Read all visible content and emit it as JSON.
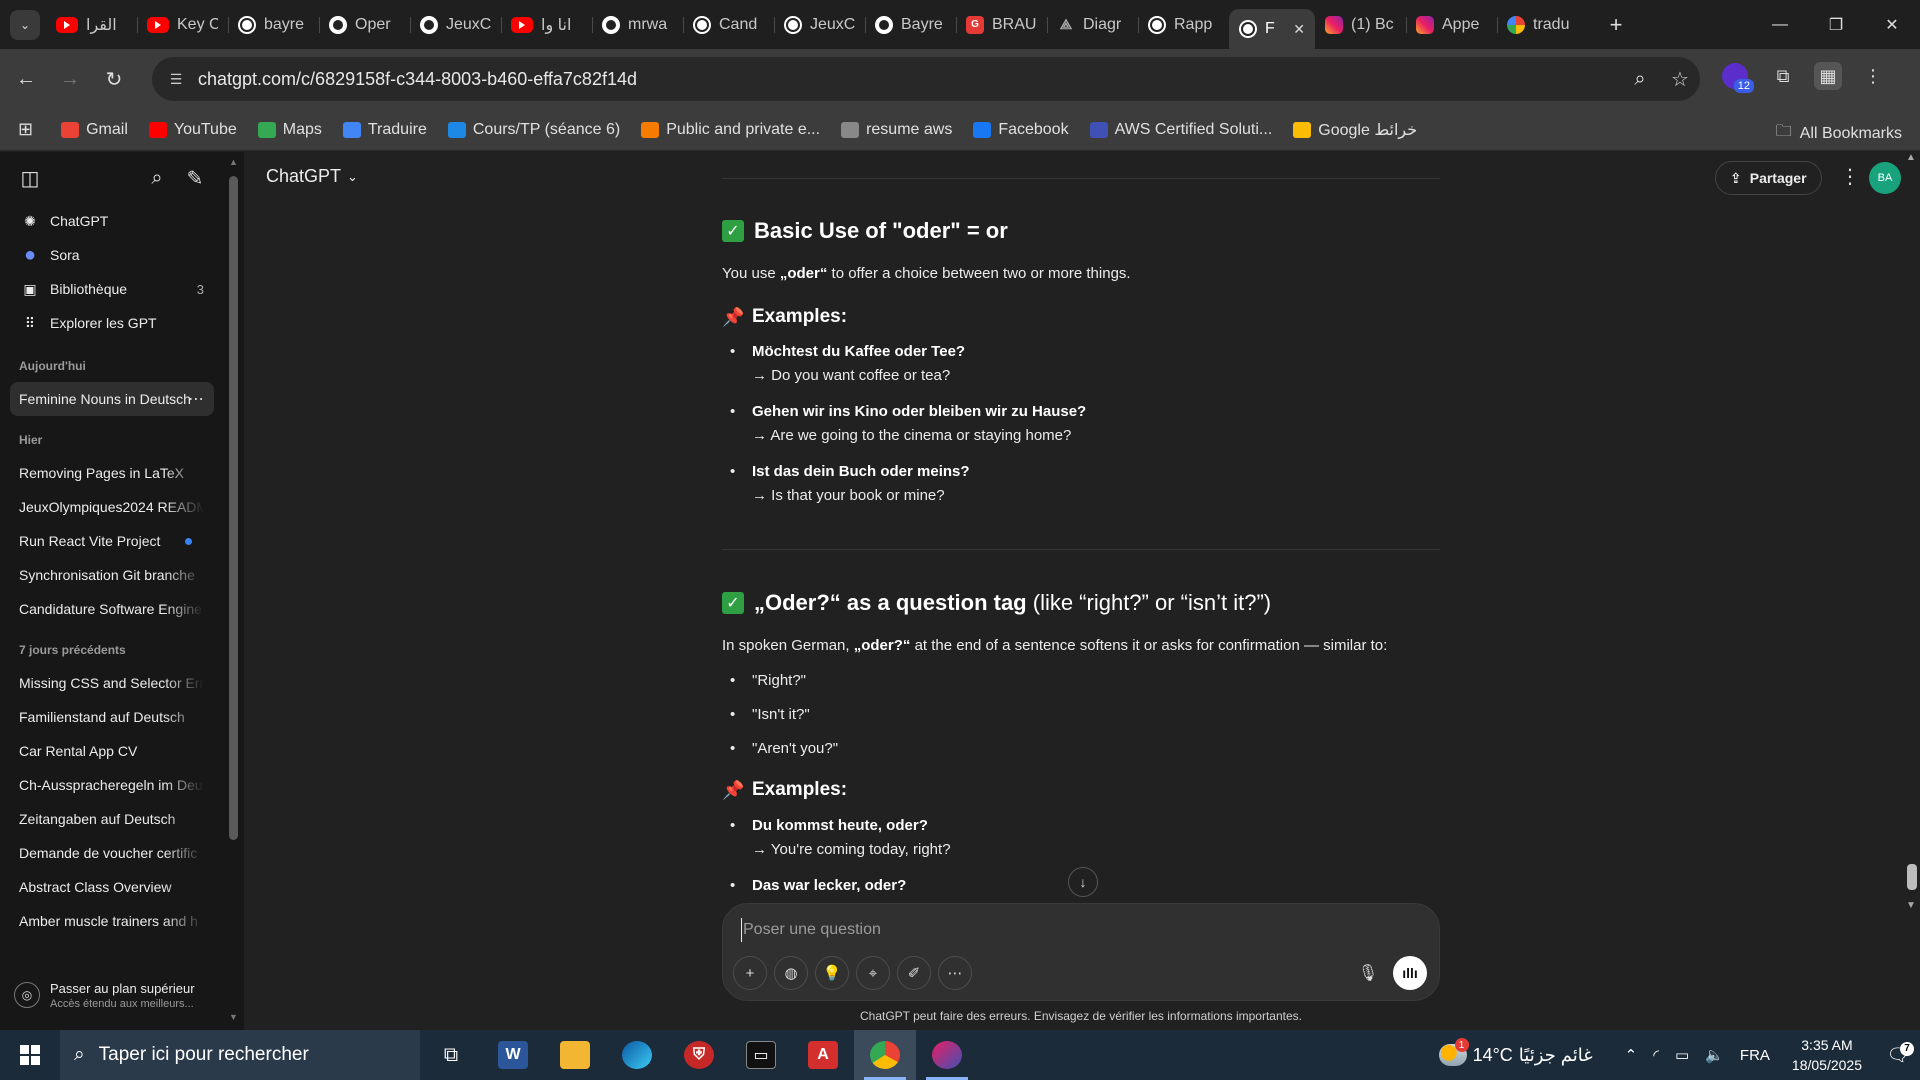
{
  "browser": {
    "tabs": [
      {
        "label": "القرا",
        "favicon": "youtube"
      },
      {
        "label": "Key C",
        "favicon": "youtube"
      },
      {
        "label": "bayre",
        "favicon": "chatgpt"
      },
      {
        "label": "Oper",
        "favicon": "github"
      },
      {
        "label": "JeuxC",
        "favicon": "github"
      },
      {
        "label": "انا وا",
        "favicon": "youtube"
      },
      {
        "label": "mrwa",
        "favicon": "github"
      },
      {
        "label": "Cand",
        "favicon": "chatgpt"
      },
      {
        "label": "JeuxC",
        "favicon": "chatgpt"
      },
      {
        "label": "Bayre",
        "favicon": "github"
      },
      {
        "label": "BRAU",
        "favicon": "red-g"
      },
      {
        "label": "Diagr",
        "favicon": "diagram"
      },
      {
        "label": "Rapp",
        "favicon": "chatgpt"
      },
      {
        "label": "F",
        "favicon": "chatgpt",
        "active": true
      },
      {
        "label": "(1) Bc",
        "favicon": "instagram"
      },
      {
        "label": "Appe",
        "favicon": "instagram"
      },
      {
        "label": "tradu",
        "favicon": "google"
      }
    ],
    "url": "chatgpt.com/c/6829158f-c344-8003-b460-effa7c82f14d",
    "extension_badge": "12",
    "bookmarks": [
      {
        "label": "Gmail",
        "icon": "gmail-icon",
        "color": "#ea4335"
      },
      {
        "label": "YouTube",
        "icon": "youtube-icon",
        "color": "#ff0000"
      },
      {
        "label": "Maps",
        "icon": "maps-icon",
        "color": "#34a853"
      },
      {
        "label": "Traduire",
        "icon": "translate-icon",
        "color": "#4285f4"
      },
      {
        "label": "Cours/TP (séance 6)",
        "icon": "classroom-icon",
        "color": "#1e88e5"
      },
      {
        "label": "Public and private e...",
        "icon": "pearson-icon",
        "color": "#f57c00"
      },
      {
        "label": "resume aws",
        "icon": "globe-icon",
        "color": "#888888"
      },
      {
        "label": "Facebook",
        "icon": "facebook-icon",
        "color": "#1877f2"
      },
      {
        "label": "AWS Certified Soluti...",
        "icon": "aws-icon",
        "color": "#3f51b5"
      },
      {
        "label": "Google خرائط",
        "icon": "maps-icon",
        "color": "#fbbc05"
      }
    ],
    "all_bookmarks": "All Bookmarks"
  },
  "sidebar": {
    "nav": [
      {
        "label": "ChatGPT",
        "icon": "chatgpt-icon"
      },
      {
        "label": "Sora",
        "icon": "sora-icon"
      },
      {
        "label": "Bibliothèque",
        "icon": "library-icon",
        "count": "3"
      },
      {
        "label": "Explorer les GPT",
        "icon": "grid-icon"
      }
    ],
    "today_label": "Aujourd'hui",
    "today": [
      "Feminine Nouns in Deutsch"
    ],
    "yesterday_label": "Hier",
    "yesterday": [
      "Removing Pages in LaTeX",
      "JeuxOlympiques2024 READM",
      "Run React Vite Project",
      "Synchronisation Git branche",
      "Candidature Software Engine"
    ],
    "week_label": "7 jours précédents",
    "week": [
      "Missing CSS and Selector Err",
      "Familienstand auf Deutsch",
      "Car Rental App CV",
      "Ch-Ausspracheregeln im Deu",
      "Zeitangaben auf Deutsch",
      "Demande de voucher certific",
      "Abstract Class Overview",
      "Amber muscle trainers and h"
    ],
    "upgrade_title": "Passer au plan supérieur",
    "upgrade_sub": "Accès étendu aux meilleurs..."
  },
  "header": {
    "model": "ChatGPT",
    "share": "Partager",
    "avatar": "BA"
  },
  "content": {
    "s1_title": "Basic Use of \"oder\" = or",
    "s1_intro_pre": "You use ",
    "s1_intro_bold": "„oder“",
    "s1_intro_post": " to offer a choice between two or more things.",
    "examples_label": "Examples:",
    "s1_examples": [
      {
        "de": "Möchtest du Kaffee oder Tee?",
        "en": "→ Do you want coffee or tea?"
      },
      {
        "de": "Gehen wir ins Kino oder bleiben wir zu Hause?",
        "en": "→ Are we going to the cinema or staying home?"
      },
      {
        "de": "Ist das dein Buch oder meins?",
        "en": "→ Is that your book or mine?"
      }
    ],
    "s2_title_bold1": "„Oder?“ as a ",
    "s2_title_bold2": "question tag",
    "s2_title_rest": " (like “right?” or “isn’t it?”)",
    "s2_intro_pre": "In spoken German, ",
    "s2_intro_bold": "„oder?“",
    "s2_intro_post": " at the end of a sentence softens it or asks for confirmation — similar to:",
    "s2_tags": [
      "\"Right?\"",
      "\"Isn't it?\"",
      "\"Aren't you?\""
    ],
    "s2_examples": [
      {
        "de": "Du kommst heute, oder?",
        "en": "→ You're coming today, right?"
      },
      {
        "de": "Das war lecker, oder?",
        "en": ""
      }
    ]
  },
  "composer": {
    "placeholder": "Poser une question",
    "disclaimer": "ChatGPT peut faire des erreurs. Envisagez de vérifier les informations importantes."
  },
  "taskbar": {
    "search_placeholder": "Taper ici pour rechercher",
    "weather_temp": "14°C",
    "weather_text": "غائم جزئيًا",
    "weather_badge": "1",
    "language": "FRA",
    "time": "3:35 AM",
    "date": "18/05/2025",
    "notifications": "7"
  }
}
